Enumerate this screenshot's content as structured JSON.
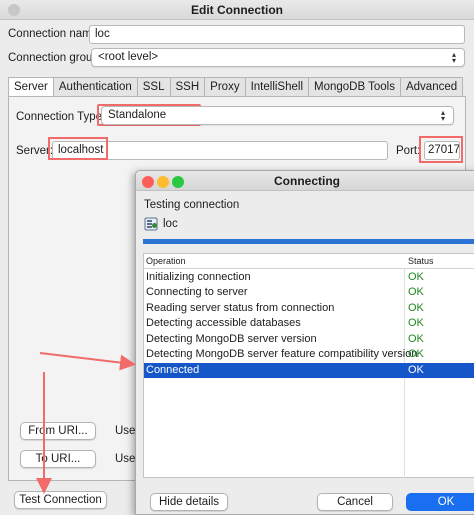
{
  "window": {
    "title": "Edit Connection"
  },
  "form": {
    "connection_name_label": "Connection name:",
    "connection_name_value": "loc",
    "connection_group_label": "Connection group:",
    "connection_group_value": "<root level>"
  },
  "tabs": [
    "Server",
    "Authentication",
    "SSL",
    "SSH",
    "Proxy",
    "IntelliShell",
    "MongoDB Tools",
    "Advanced"
  ],
  "server": {
    "connection_type_label": "Connection Type:",
    "connection_type_value": "Standalone",
    "server_label": "Server:",
    "server_value": "localhost",
    "port_label": "Port:",
    "port_value": "27017",
    "from_uri_label": "From URI...",
    "from_uri_hint": "Use t",
    "to_uri_label": "To URI...",
    "to_uri_hint": "Use t"
  },
  "footer": {
    "test_connection_label": "Test Connection"
  },
  "dialog": {
    "title": "Connecting",
    "testing_label": "Testing connection",
    "connection_name": "loc",
    "progress": 1.0,
    "columns": {
      "operation": "Operation",
      "status": "Status"
    },
    "rows": [
      {
        "operation": "Initializing connection",
        "status": "OK"
      },
      {
        "operation": "Connecting to server",
        "status": "OK"
      },
      {
        "operation": "Reading server status from connection",
        "status": "OK"
      },
      {
        "operation": "Detecting accessible databases",
        "status": "OK"
      },
      {
        "operation": "Detecting MongoDB server version",
        "status": "OK"
      },
      {
        "operation": "Detecting MongoDB server feature compatibility version",
        "status": "OK"
      },
      {
        "operation": "Connected",
        "status": "OK"
      }
    ],
    "hide_details_label": "Hide details",
    "cancel_label": "Cancel",
    "ok_label": "OK"
  },
  "colors": {
    "highlight": "#f26b6b",
    "selection": "#1557c9",
    "status_ok": "#1f8a1f",
    "progress": "#2c74d6",
    "close": "#fc5f57",
    "minimize": "#fdbc2e",
    "maximize": "#28c840"
  },
  "icons": [
    "close-icon",
    "minimize-icon",
    "maximize-icon",
    "database-icon",
    "chevron-up-down-icon",
    "arrow-icon"
  ]
}
